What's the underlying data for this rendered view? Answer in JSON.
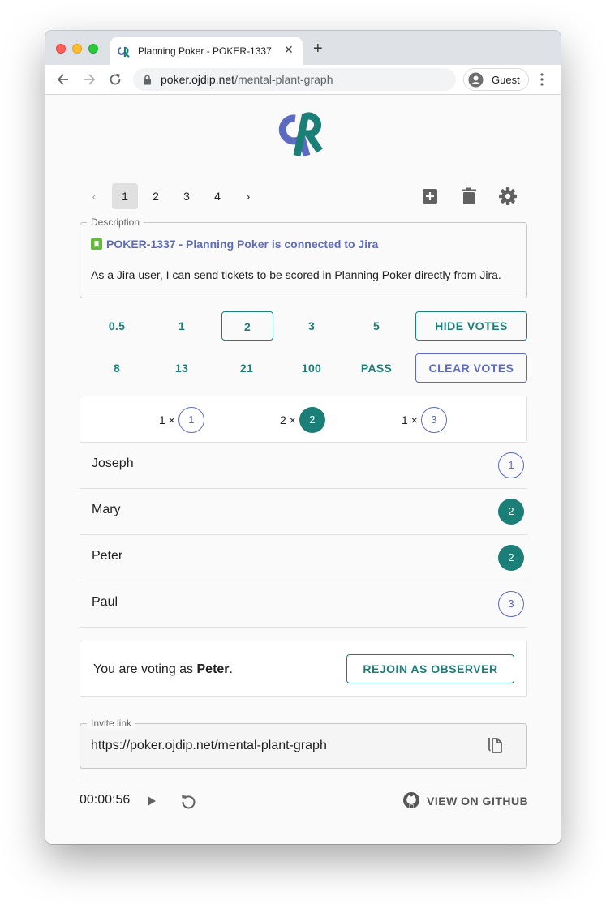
{
  "browser": {
    "tab_title": "Planning Poker - POKER-1337",
    "url_host": "poker.ojdip.net",
    "url_path": "/mental-plant-graph",
    "profile_label": "Guest"
  },
  "pagination": {
    "pages": [
      "1",
      "2",
      "3",
      "4"
    ],
    "current": "1"
  },
  "description": {
    "legend": "Description",
    "issue_link": "POKER-1337 - Planning Poker is connected to Jira",
    "text": "As a Jira user, I can send tickets to be scored in Planning Poker directly from Jira."
  },
  "cards": {
    "row1": [
      "0.5",
      "1",
      "2",
      "3",
      "5"
    ],
    "row2": [
      "8",
      "13",
      "21",
      "100",
      "PASS"
    ],
    "selected": "2"
  },
  "actions": {
    "hide_votes": "HIDE VOTES",
    "clear_votes": "CLEAR VOTES"
  },
  "summary": [
    {
      "count": "1 ×",
      "value": "1",
      "style": "outline"
    },
    {
      "count": "2 ×",
      "value": "2",
      "style": "filled"
    },
    {
      "count": "1 ×",
      "value": "3",
      "style": "outline"
    }
  ],
  "voters": [
    {
      "name": "Joseph",
      "vote": "1",
      "style": "outline"
    },
    {
      "name": "Mary",
      "vote": "2",
      "style": "filled"
    },
    {
      "name": "Peter",
      "vote": "2",
      "style": "filled"
    },
    {
      "name": "Paul",
      "vote": "3",
      "style": "outline"
    }
  ],
  "observer": {
    "prefix": "You are voting as ",
    "name": "Peter",
    "suffix": ".",
    "rejoin_label": "REJOIN AS OBSERVER"
  },
  "invite": {
    "legend": "Invite link",
    "url": "https://poker.ojdip.net/mental-plant-graph"
  },
  "footer": {
    "timer": "00:00:56",
    "github_label": "VIEW ON GITHUB"
  },
  "colors": {
    "teal": "#1b7f78",
    "indigo": "#5c6bc0",
    "jira_green": "#63ba3c"
  }
}
